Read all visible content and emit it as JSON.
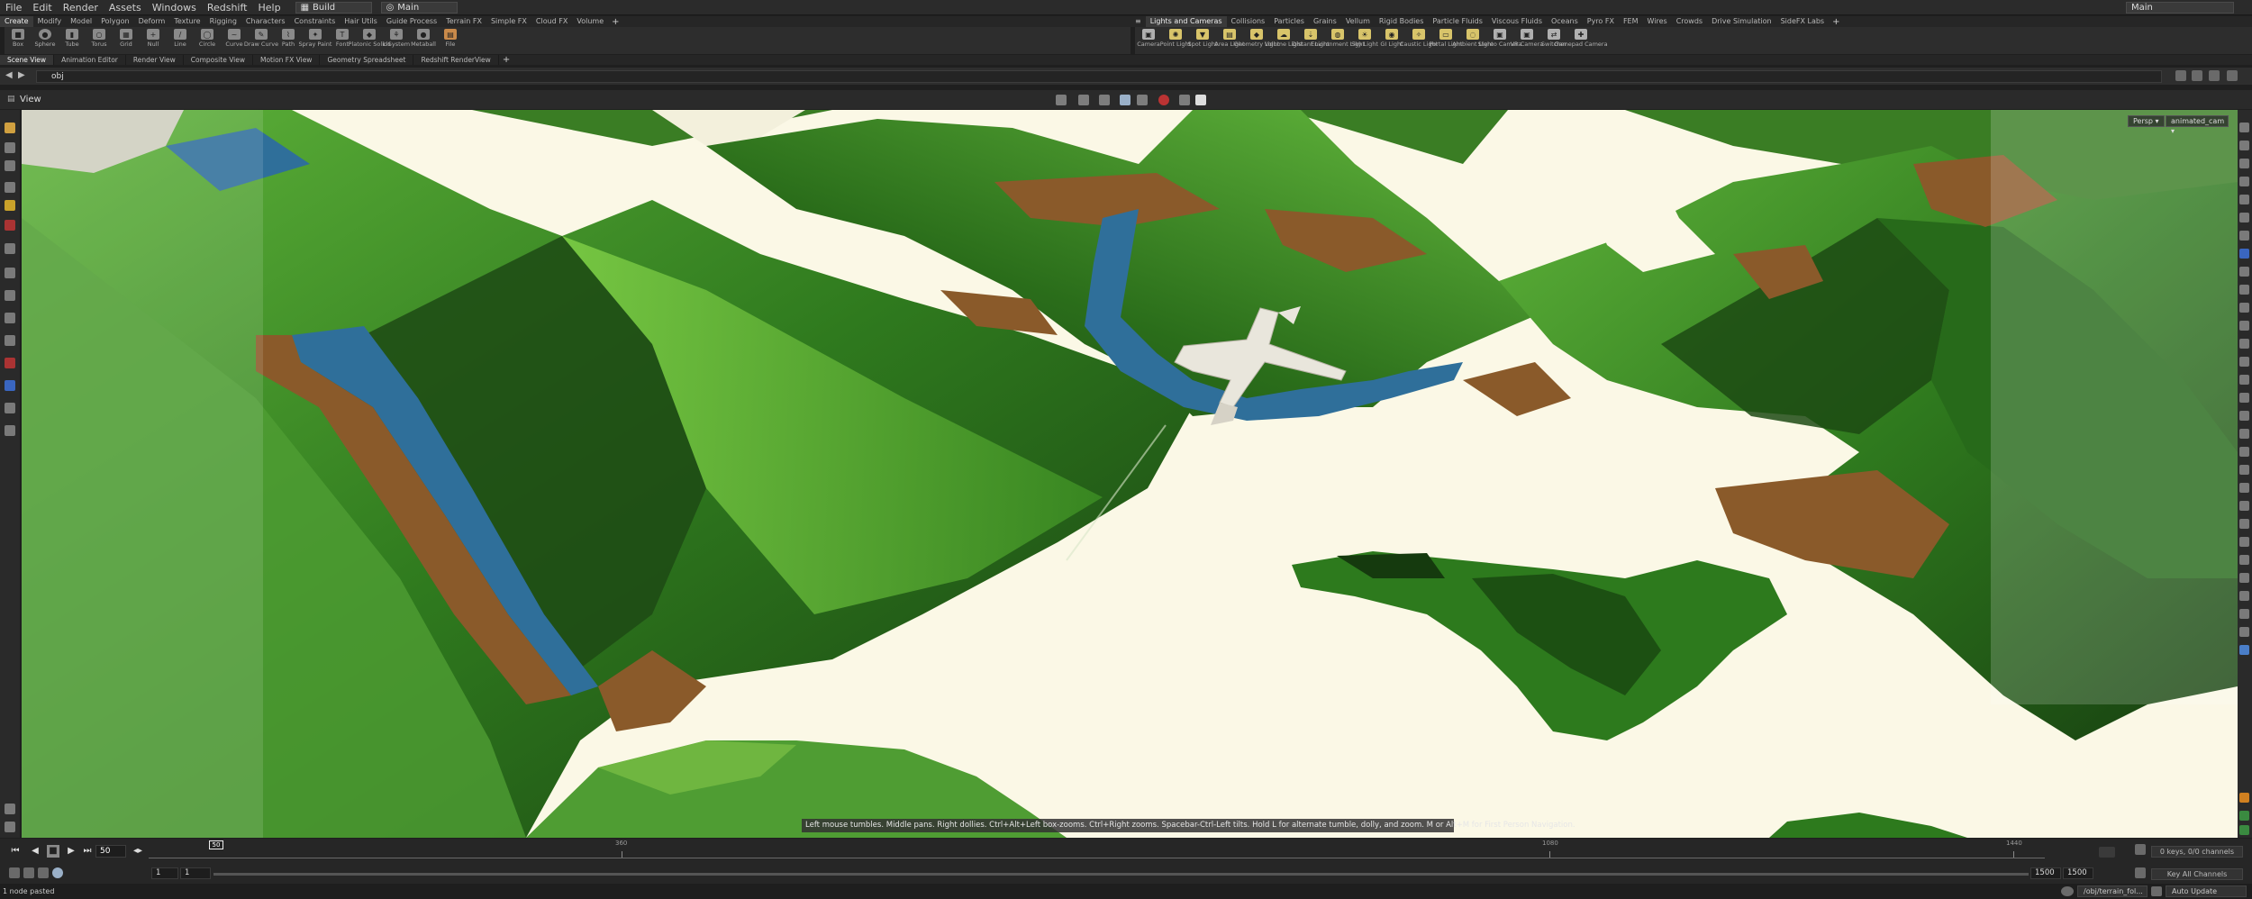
{
  "menubar": {
    "items": [
      "File",
      "Edit",
      "Render",
      "Assets",
      "Windows",
      "Redshift",
      "Help"
    ],
    "build_label": "Build",
    "desktop_label": "Main",
    "right_desktop_label": "Main"
  },
  "shelf_left": {
    "tabs": [
      "Create",
      "Modify",
      "Model",
      "Polygon",
      "Deform",
      "Texture",
      "Rigging",
      "Characters",
      "Constraints",
      "Hair Utils",
      "Guide Process",
      "Terrain FX",
      "Simple FX",
      "Cloud FX",
      "Volume"
    ],
    "tools": [
      "Box",
      "Sphere",
      "Tube",
      "Torus",
      "Grid",
      "Null",
      "Line",
      "Circle",
      "Curve",
      "Draw Curve",
      "Path",
      "Spray Paint",
      "Font",
      "Platonic Solids",
      "L-System",
      "Metaball",
      "File"
    ]
  },
  "shelf_right": {
    "tabs": [
      "Lights and Cameras",
      "Collisions",
      "Particles",
      "Grains",
      "Vellum",
      "Rigid Bodies",
      "Particle Fluids",
      "Viscous Fluids",
      "Oceans",
      "Pyro FX",
      "FEM",
      "Wires",
      "Crowds",
      "Drive Simulation",
      "SideFX Labs"
    ],
    "tools": [
      "Camera",
      "Point Light",
      "Spot Light",
      "Area Light",
      "Geometry Light",
      "Volume Light",
      "Distant Light",
      "Environment Light",
      "Sky Light",
      "GI Light",
      "Caustic Light",
      "Portal Light",
      "Ambient Light",
      "Stereo Camera",
      "VR Camera",
      "Switcher",
      "Gamepad Camera"
    ]
  },
  "pane_tabs": [
    "Scene View",
    "Animation Editor",
    "Render View",
    "Composite View",
    "Motion FX View",
    "Geometry Spreadsheet",
    "Redshift RenderView"
  ],
  "path": {
    "value": "obj"
  },
  "viewer": {
    "title": "View",
    "persp_label": "Persp",
    "camera_label": "animated_cam",
    "status_message": "Left mouse tumbles. Middle pans. Right dollies. Ctrl+Alt+Left box-zooms. Ctrl+Right zooms. Spacebar-Ctrl-Left tilts. Hold L for alternate tumble, dolly, and zoom.     M or Alt+M for First Person Navigation."
  },
  "timeline": {
    "current_frame": "50",
    "cursor_frame": "50",
    "tick_labels": [
      "360",
      "1080",
      "1440"
    ],
    "keys_label": "0 keys, 0/0 channels",
    "key_all_label": "Key All Channels"
  },
  "range": {
    "start": "1",
    "start2": "1",
    "end": "1500",
    "end2": "1500"
  },
  "status": {
    "message": "1 node pasted",
    "node_path": "/obj/terrain_fol...",
    "auto_update": "Auto Update"
  },
  "colors": {
    "terrain_green": "#3f8a2a",
    "terrain_dark": "#1e4a15",
    "terrain_brown": "#8a5a2a",
    "water": "#2f6f9a",
    "flat": "#fbf8e6"
  }
}
